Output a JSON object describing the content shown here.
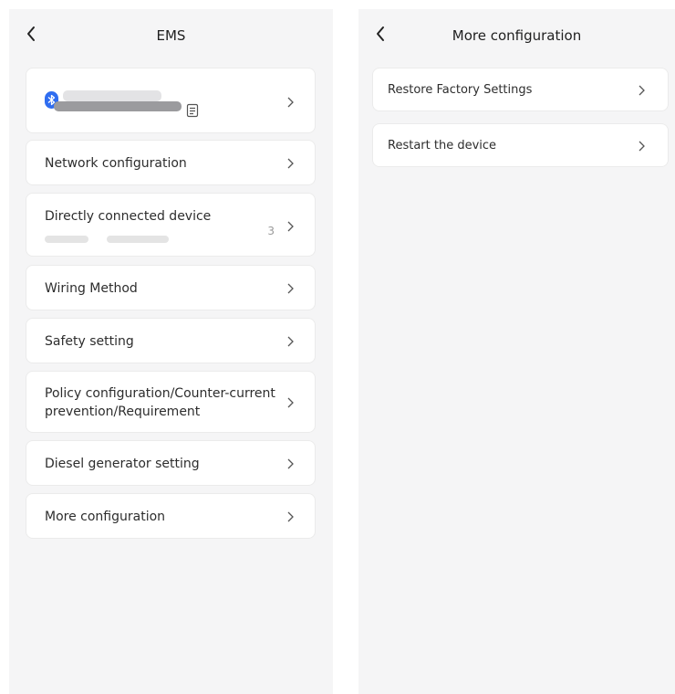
{
  "left_screen": {
    "title": "EMS",
    "device_card": {
      "icon": "bluetooth-icon",
      "copy_icon": "copy-icon"
    },
    "menu": [
      {
        "key": "network",
        "label": "Network configuration"
      },
      {
        "key": "direct",
        "label": "Directly connected device",
        "count": "3"
      },
      {
        "key": "wiring",
        "label": "Wiring Method"
      },
      {
        "key": "safety",
        "label": "Safety setting"
      },
      {
        "key": "policy",
        "label_line1": "Policy configuration/Counter-current",
        "label_line2": "prevention/Requirement"
      },
      {
        "key": "diesel",
        "label": "Diesel generator setting"
      },
      {
        "key": "more",
        "label": "More configuration"
      }
    ]
  },
  "right_screen": {
    "title": "More configuration",
    "menu": [
      {
        "key": "restore",
        "label": "Restore Factory Settings"
      },
      {
        "key": "restart",
        "label": "Restart the device"
      }
    ]
  },
  "colors": {
    "background": "#f5f5f6",
    "card": "#ffffff",
    "accent": "#2f6df0",
    "chevron": "#555555"
  }
}
